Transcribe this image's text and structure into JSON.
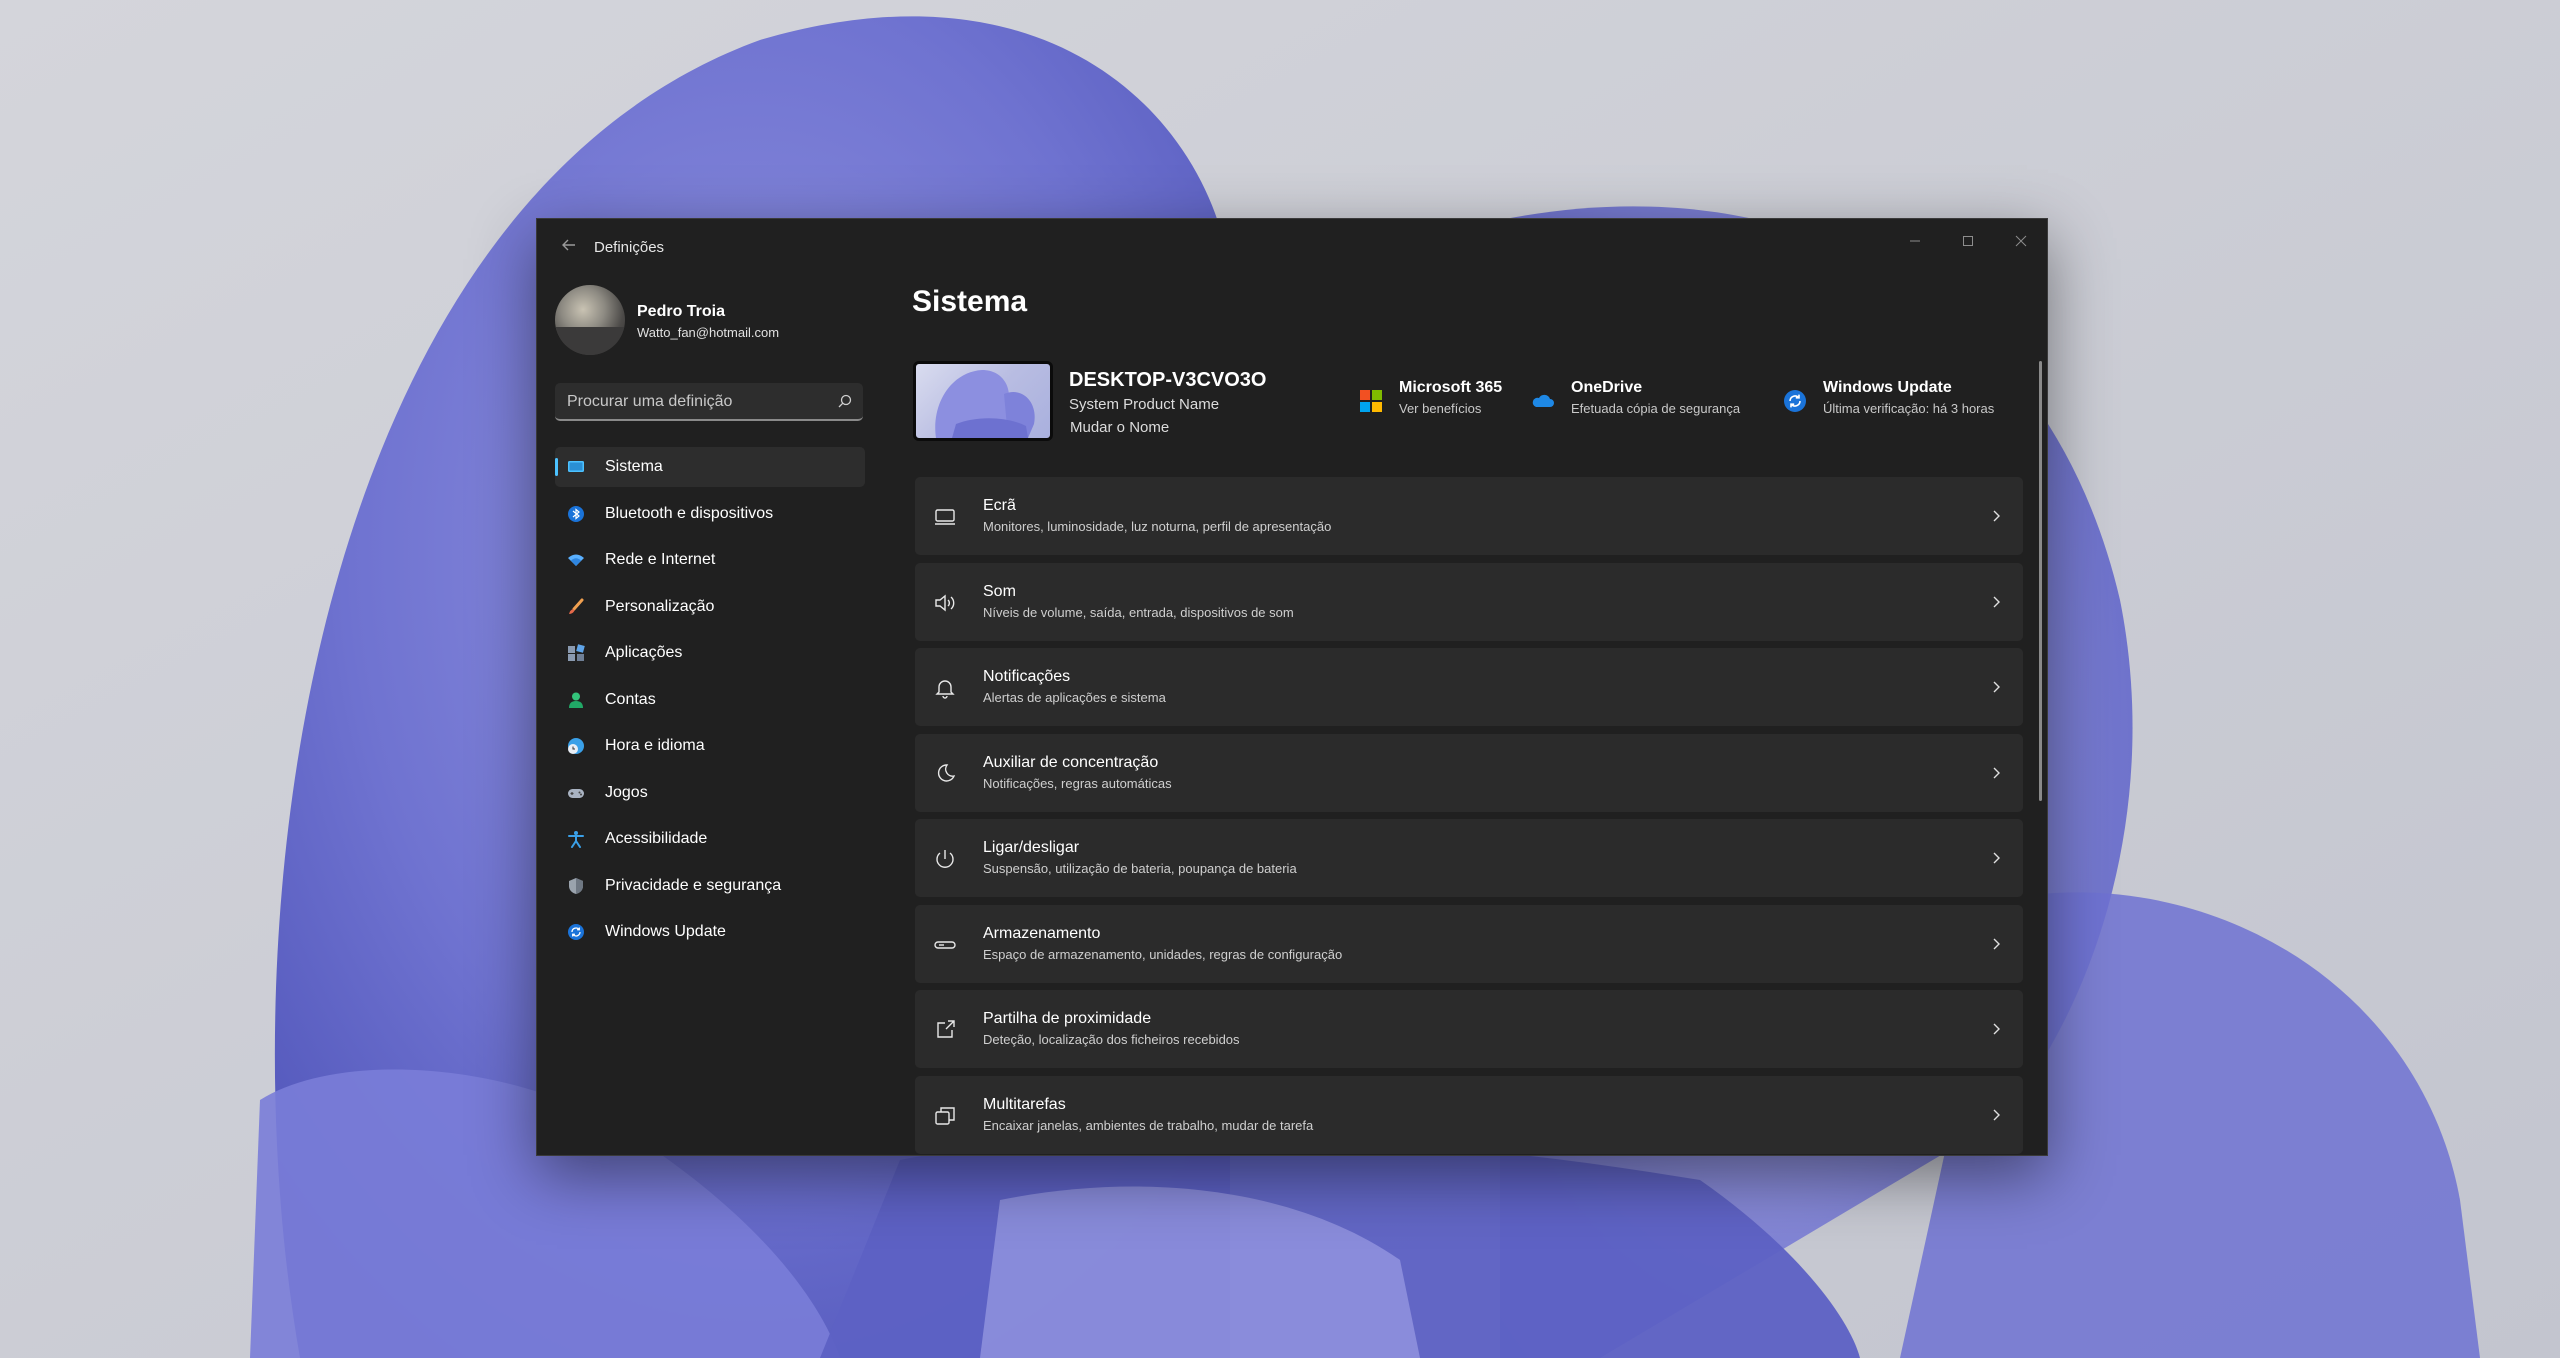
{
  "window": {
    "title": "Definições"
  },
  "profile": {
    "name": "Pedro Troia",
    "email": "Watto_fan@hotmail.com"
  },
  "search": {
    "placeholder": "Procurar uma definição"
  },
  "nav": [
    {
      "label": "Sistema",
      "icon": "monitor-icon",
      "active": true
    },
    {
      "label": "Bluetooth e dispositivos",
      "icon": "bluetooth-icon"
    },
    {
      "label": "Rede e Internet",
      "icon": "wifi-icon"
    },
    {
      "label": "Personalização",
      "icon": "brush-icon"
    },
    {
      "label": "Aplicações",
      "icon": "apps-icon"
    },
    {
      "label": "Contas",
      "icon": "person-icon"
    },
    {
      "label": "Hora e idioma",
      "icon": "globe-clock-icon"
    },
    {
      "label": "Jogos",
      "icon": "gamepad-icon"
    },
    {
      "label": "Acessibilidade",
      "icon": "accessibility-icon"
    },
    {
      "label": "Privacidade e segurança",
      "icon": "shield-icon"
    },
    {
      "label": "Windows Update",
      "icon": "update-icon"
    }
  ],
  "main": {
    "title": "Sistema",
    "device": {
      "name": "DESKTOP-V3CVO3O",
      "model": "System Product Name",
      "rename": "Mudar o Nome"
    },
    "status": [
      {
        "title": "Microsoft 365",
        "sub": "Ver benefícios",
        "icon": "microsoft-logo-icon"
      },
      {
        "title": "OneDrive",
        "sub": "Efetuada cópia de segurança",
        "icon": "onedrive-cloud-icon"
      },
      {
        "title": "Windows Update",
        "sub": "Última verificação: há 3 horas",
        "icon": "update-icon"
      }
    ],
    "settings": [
      {
        "title": "Ecrã",
        "sub": "Monitores, luminosidade, luz noturna, perfil de apresentação",
        "icon": "display-icon"
      },
      {
        "title": "Som",
        "sub": "Níveis de volume, saída, entrada, dispositivos de som",
        "icon": "speaker-icon"
      },
      {
        "title": "Notificações",
        "sub": "Alertas de aplicações e sistema",
        "icon": "bell-icon"
      },
      {
        "title": "Auxiliar de concentração",
        "sub": "Notificações, regras automáticas",
        "icon": "moon-icon"
      },
      {
        "title": "Ligar/desligar",
        "sub": "Suspensão, utilização de bateria, poupança de bateria",
        "icon": "power-icon"
      },
      {
        "title": "Armazenamento",
        "sub": "Espaço de armazenamento, unidades, regras de configuração",
        "icon": "storage-icon"
      },
      {
        "title": "Partilha de proximidade",
        "sub": "Deteção, localização dos ficheiros recebidos",
        "icon": "share-icon"
      },
      {
        "title": "Multitarefas",
        "sub": "Encaixar janelas, ambientes de trabalho, mudar de tarefa",
        "icon": "multitask-icon"
      }
    ]
  },
  "colors": {
    "accent": "#4cc2ff",
    "window_bg": "#202020",
    "card_bg": "#2b2b2b"
  }
}
